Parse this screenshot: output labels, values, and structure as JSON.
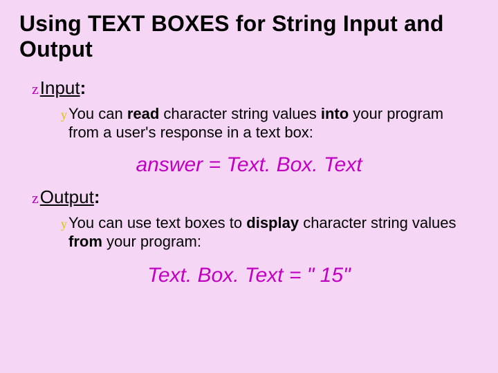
{
  "title": "Using TEXT BOXES for String Input and Output",
  "sections": {
    "input": {
      "label": "Input",
      "colon": ":",
      "body_pre": "You can ",
      "body_b1": "read",
      "body_mid": " character string values ",
      "body_b2": "into",
      "body_post": " your program from a user's response in a text box:",
      "code": "answer =  Text. Box. Text"
    },
    "output": {
      "label": "Output",
      "colon": ":",
      "body_pre": "You can use text boxes to ",
      "body_b1": "display",
      "body_mid": " character string values ",
      "body_b2": "from",
      "body_post": " your program:",
      "code": "Text. Box. Text = \" 15\""
    }
  },
  "bullets": {
    "z": "z",
    "y": "y"
  }
}
